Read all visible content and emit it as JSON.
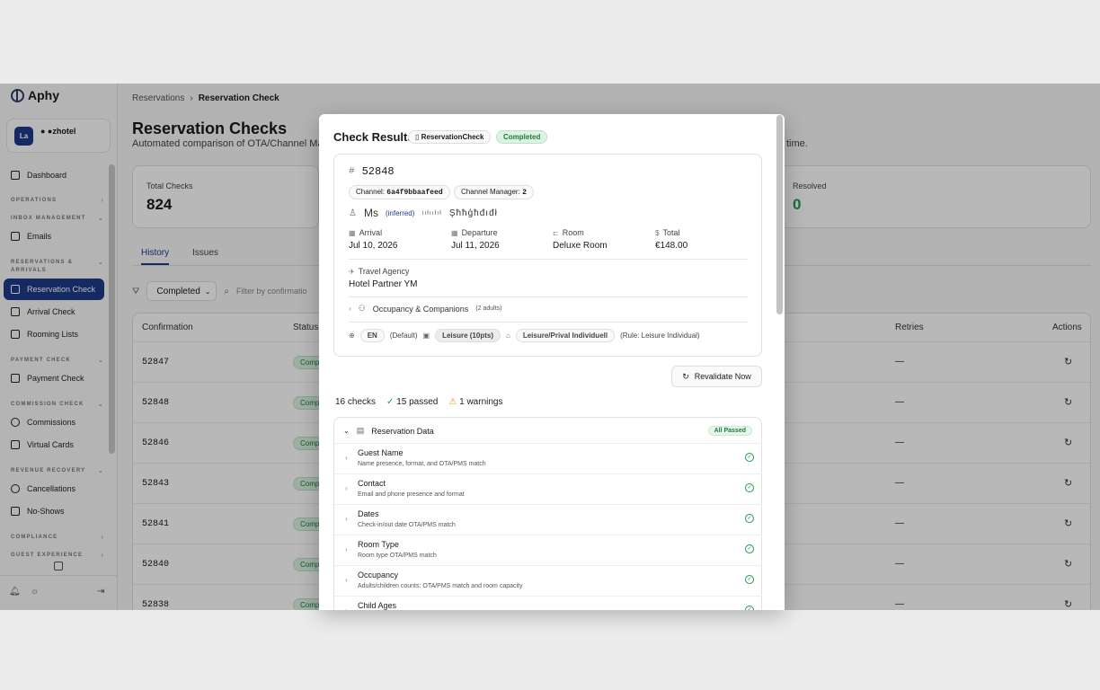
{
  "brand": {
    "name": "Aphy"
  },
  "hotel": {
    "initials": "La",
    "name": "● ●zhotel"
  },
  "sidebar": {
    "dashboard": "Dashboard",
    "sections": {
      "operations": "OPERATIONS",
      "inbox": "INBOX MANAGEMENT",
      "reservations": "RESERVATIONS & ARRIVALS",
      "payment": "PAYMENT CHECK",
      "commission": "COMMISSION CHECK",
      "revenue": "REVENUE RECOVERY",
      "compliance": "COMPLIANCE",
      "guest": "GUEST EXPERIENCE"
    },
    "items": {
      "emails": "Emails",
      "reservation_check": "Reservation Check",
      "arrival_check": "Arrival Check",
      "rooming_lists": "Rooming Lists",
      "payment_check": "Payment Check",
      "commissions": "Commissions",
      "virtual_cards": "Virtual Cards",
      "cancellations": "Cancellations",
      "no_shows": "No-Shows"
    }
  },
  "breadcrumb": {
    "parent": "Reservations",
    "sep": "›",
    "current": "Reservation Check"
  },
  "page": {
    "title": "Reservation Checks",
    "subtitle": "Automated comparison of OTA/Channel Man",
    "subtitle_tail": "time."
  },
  "stats": {
    "total_label": "Total Checks",
    "total_value": "824",
    "resolved_label": "Resolved",
    "resolved_value": "0"
  },
  "tabs": {
    "history": "History",
    "issues": "Issues"
  },
  "filters": {
    "status": "Completed",
    "search_placeholder": "Filter by confirmatio"
  },
  "table": {
    "headers": {
      "confirmation": "Confirmation",
      "status": "Status",
      "retries": "Retries",
      "actions": "Actions"
    },
    "rows": [
      {
        "conf": "52847",
        "status": "Comp",
        "retries": "—"
      },
      {
        "conf": "52848",
        "status": "Comp",
        "retries": "—"
      },
      {
        "conf": "52846",
        "status": "Comp",
        "retries": "—"
      },
      {
        "conf": "52843",
        "status": "Comp",
        "retries": "—"
      },
      {
        "conf": "52841",
        "status": "Comp",
        "retries": "—"
      },
      {
        "conf": "52840",
        "status": "Comp",
        "retries": "—"
      },
      {
        "conf": "52838",
        "status": "Comp",
        "retries": "—"
      }
    ]
  },
  "modal": {
    "title": "Check Results",
    "type_badge": "ReservationCheck",
    "status_badge": "Completed",
    "reservation": {
      "id": "52848",
      "channel_label": "Channel:",
      "channel_value": "6a4f9bbaafeed",
      "manager_label": "Channel Manager:",
      "manager_value": "2",
      "guest_title": "Ms",
      "inferred": "(inferred)",
      "guest_garbled_1": "ııłııłıł",
      "guest_garbled_2": "Şħħģħđıđł",
      "arrival_label": "Arrival",
      "arrival_value": "Jul 10, 2026",
      "departure_label": "Departure",
      "departure_value": "Jul 11, 2026",
      "room_label": "Room",
      "room_value": "Deluxe Room",
      "total_label": "Total",
      "total_value": "€148.00",
      "agency_label": "Travel Agency",
      "agency_value": "Hotel Partner YM",
      "occupancy_label": "Occupancy & Companions",
      "occupancy_count": "(2 adults)",
      "lang": "EN",
      "lang_default": "(Default)",
      "segment": "Leisure (10pts)",
      "rate_tag": "Leisure/Prival Individuell",
      "rule": "(Rule: Leisure Individual)"
    },
    "revalidate": "Revalidate Now",
    "summary": {
      "checks": "16 checks",
      "passed": "15 passed",
      "warnings": "1 warnings"
    },
    "group": {
      "name": "Reservation Data",
      "status": "All Passed"
    },
    "checks": [
      {
        "name": "Guest Name",
        "desc": "Name presence, format, and OTA/PMS match"
      },
      {
        "name": "Contact",
        "desc": "Email and phone presence and format"
      },
      {
        "name": "Dates",
        "desc": "Check-in/out date OTA/PMS match"
      },
      {
        "name": "Room Type",
        "desc": "Room type OTA/PMS match"
      },
      {
        "name": "Occupancy",
        "desc": "Adults/children counts: OTA/PMS match and room capacity"
      },
      {
        "name": "Child Ages",
        "desc": ""
      }
    ]
  },
  "colors": {
    "accent": "#1e3a8a",
    "success": "#1f9a4d",
    "warning": "#d49b0a"
  }
}
